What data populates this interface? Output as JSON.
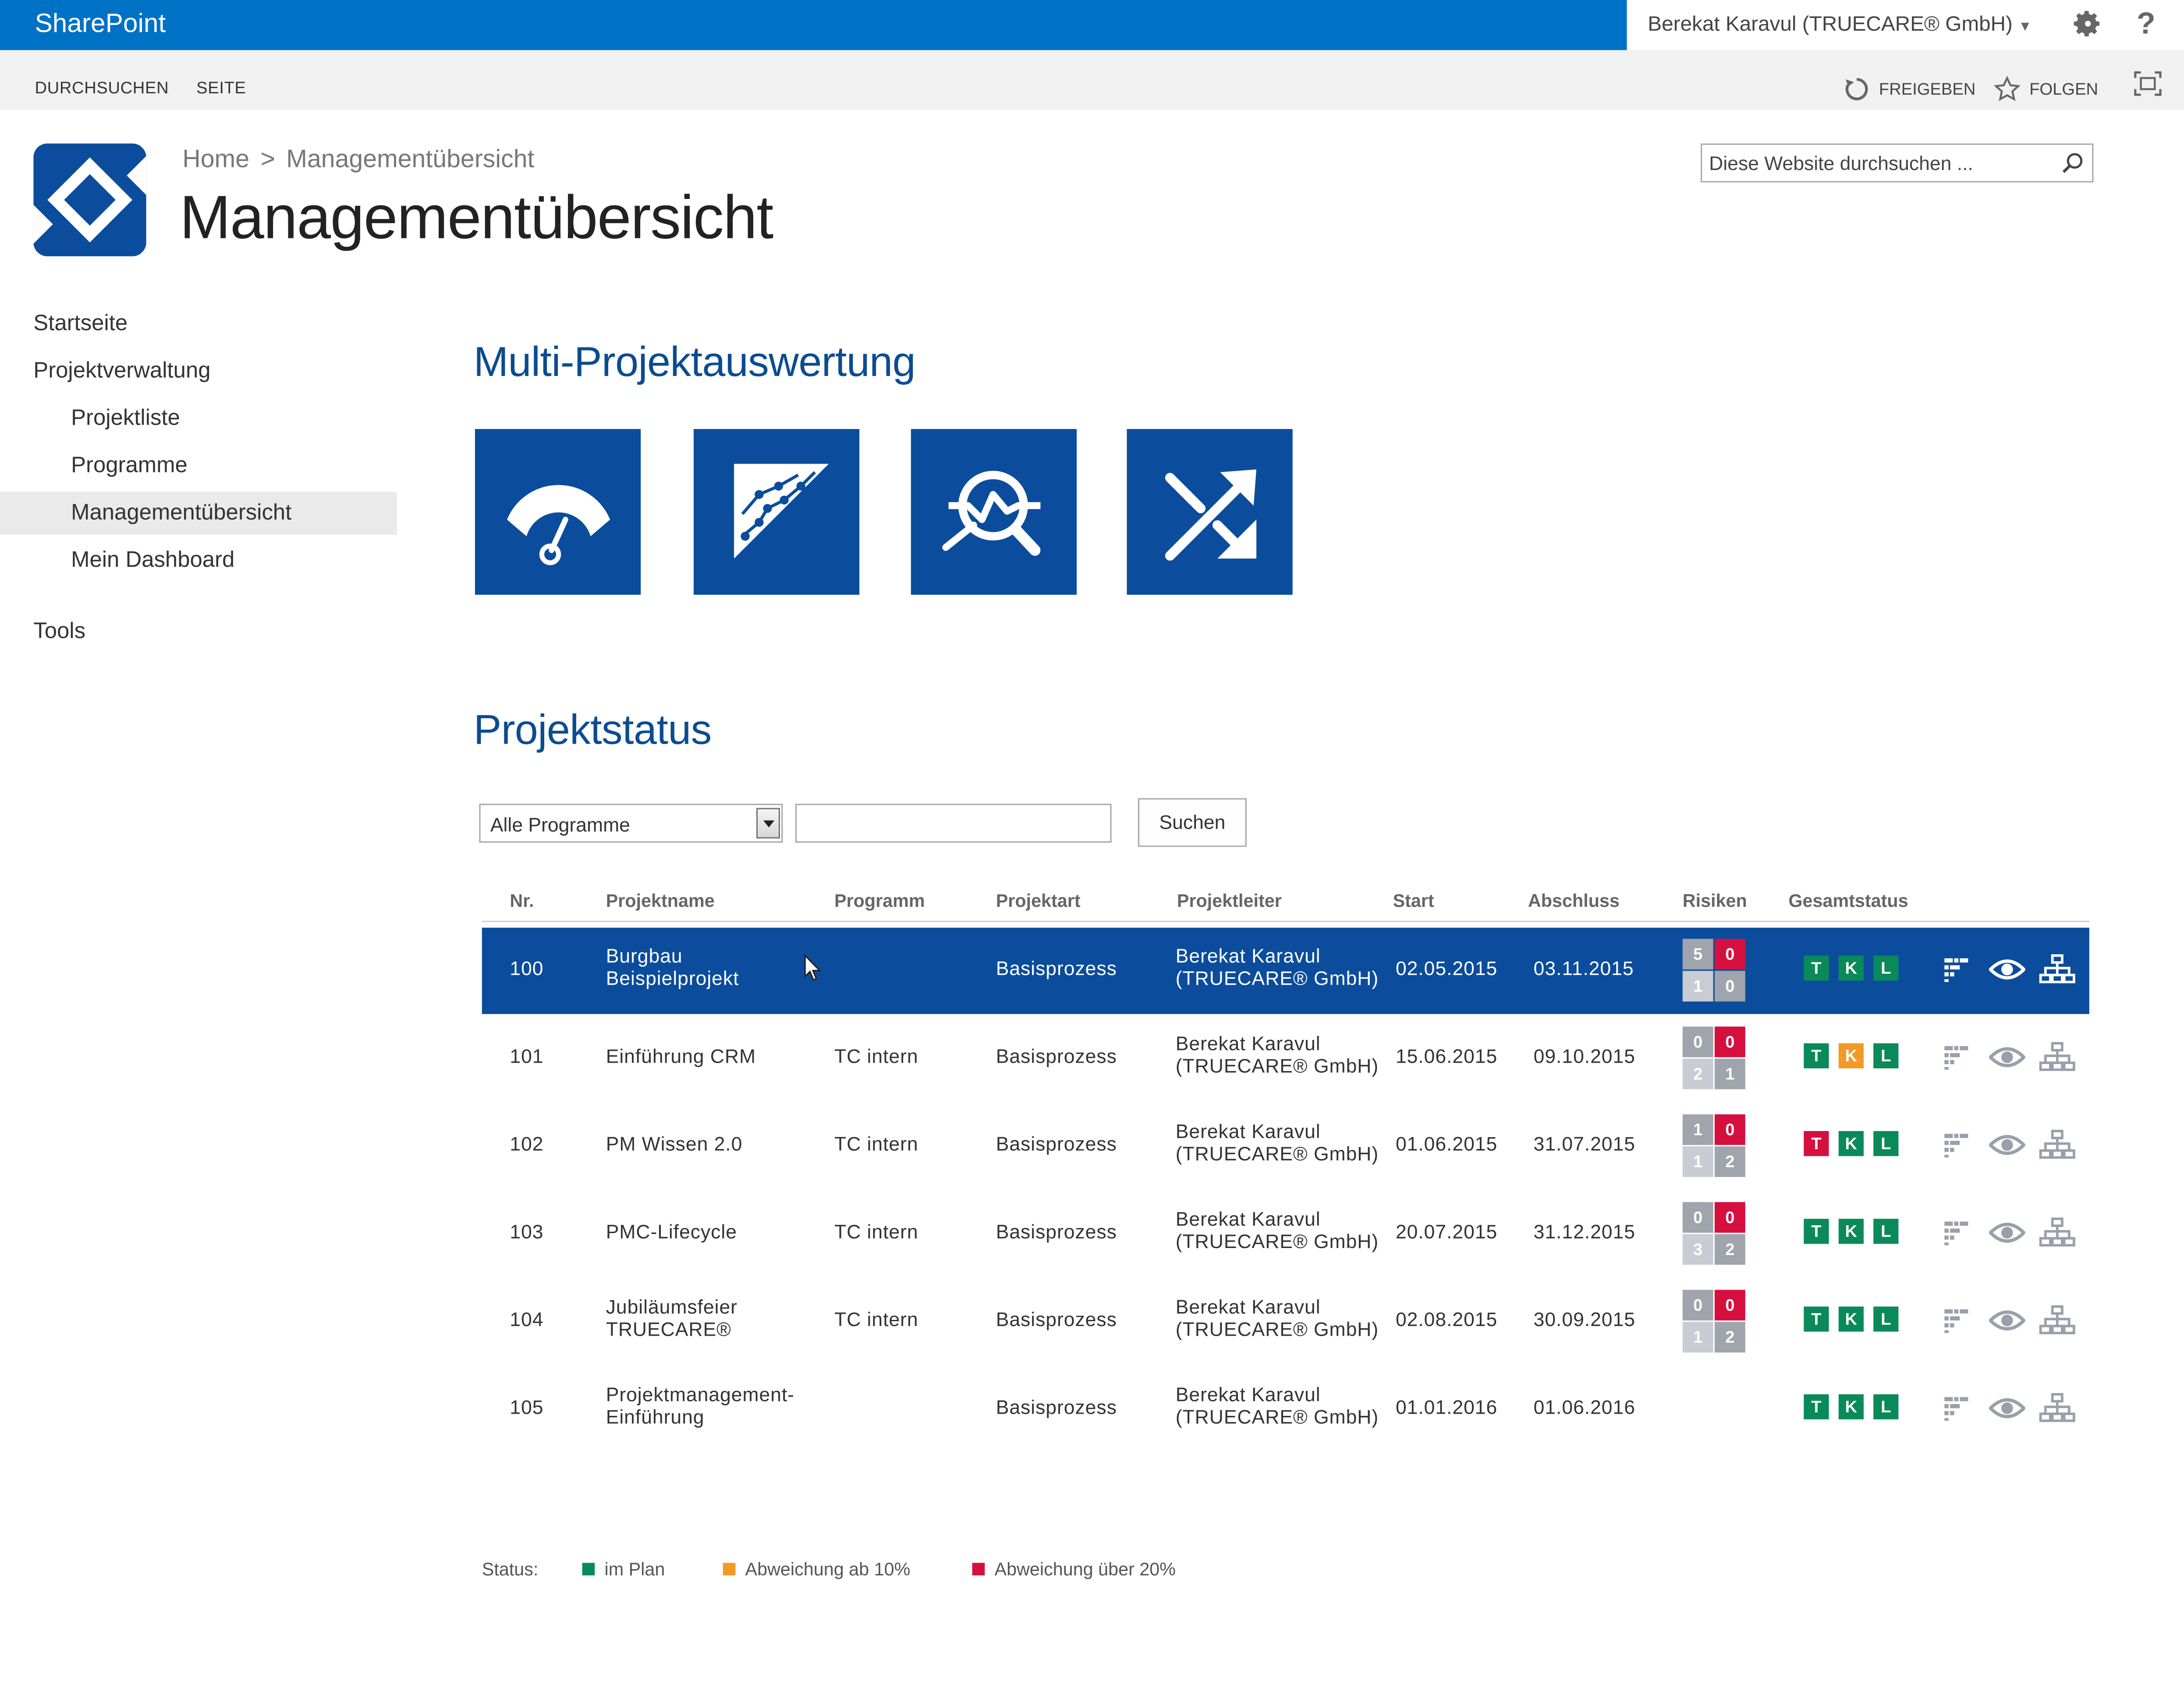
{
  "suite_bar": {
    "app_name": "SharePoint",
    "user_name": "Berekat Karavul (TRUECARE® GmbH)",
    "help_label": "?"
  },
  "ribbon": {
    "tab_browse": "DURCHSUCHEN",
    "tab_page": "SEITE",
    "share_label": "FREIGEBEN",
    "follow_label": "FOLGEN"
  },
  "header": {
    "breadcrumb_home": "Home",
    "breadcrumb_sep": ">",
    "breadcrumb_current": "Managementübersicht",
    "page_title": "Managementübersicht",
    "search_placeholder": "Diese Website durchsuchen ..."
  },
  "nav": {
    "items": [
      {
        "label": "Startseite"
      },
      {
        "label": "Projektverwaltung"
      },
      {
        "label": "Projektliste"
      },
      {
        "label": "Programme"
      },
      {
        "label": "Managementübersicht",
        "selected": true
      },
      {
        "label": "Mein Dashboard"
      },
      {
        "label": "Tools"
      }
    ]
  },
  "main": {
    "section1_title": "Multi-Projektauswertung",
    "tiles": [
      {
        "icon": "gauge-icon"
      },
      {
        "icon": "trend-chart-icon"
      },
      {
        "icon": "analysis-magnifier-icon"
      },
      {
        "icon": "shuffle-arrows-icon"
      }
    ],
    "section2_title": "Projektstatus",
    "filter_select_value": "Alle Programme",
    "filter_text_value": "",
    "search_button": "Suchen"
  },
  "table": {
    "columns": [
      "Nr.",
      "Projektname",
      "Programm",
      "Projektart",
      "Projektleiter",
      "Start",
      "Abschluss",
      "Risiken",
      "Gesamtstatus"
    ],
    "rows": [
      {
        "nr": "100",
        "name1": "Burgbau",
        "name2": "Beispielprojekt",
        "programm": "",
        "art": "Basisprozess",
        "leiter1": "Berekat Karavul",
        "leiter2": "(TRUECARE® GmbH)",
        "start": "02.05.2015",
        "ende": "03.11.2015",
        "risks": [
          "5",
          "0",
          "1",
          "0"
        ],
        "t": "T",
        "k": "K",
        "l": "L",
        "status": [
          "green",
          "green",
          "green"
        ],
        "selected": true
      },
      {
        "nr": "101",
        "name1": "Einführung CRM",
        "name2": "",
        "programm": "TC intern",
        "art": "Basisprozess",
        "leiter1": "Berekat Karavul",
        "leiter2": "(TRUECARE® GmbH)",
        "start": "15.06.2015",
        "ende": "09.10.2015",
        "risks": [
          "0",
          "0",
          "2",
          "1"
        ],
        "t": "T",
        "k": "K",
        "l": "L",
        "status": [
          "green",
          "orange",
          "green"
        ]
      },
      {
        "nr": "102",
        "name1": "PM Wissen 2.0",
        "name2": "",
        "programm": "TC intern",
        "art": "Basisprozess",
        "leiter1": "Berekat Karavul",
        "leiter2": "(TRUECARE® GmbH)",
        "start": "01.06.2015",
        "ende": "31.07.2015",
        "risks": [
          "1",
          "0",
          "1",
          "2"
        ],
        "t": "T",
        "k": "K",
        "l": "L",
        "status": [
          "red",
          "green",
          "green"
        ]
      },
      {
        "nr": "103",
        "name1": "PMC-Lifecycle",
        "name2": "",
        "programm": "TC intern",
        "art": "Basisprozess",
        "leiter1": "Berekat Karavul",
        "leiter2": "(TRUECARE® GmbH)",
        "start": "20.07.2015",
        "ende": "31.12.2015",
        "risks": [
          "0",
          "0",
          "3",
          "2"
        ],
        "t": "T",
        "k": "K",
        "l": "L",
        "status": [
          "green",
          "green",
          "green"
        ]
      },
      {
        "nr": "104",
        "name1": "Jubiläumsfeier",
        "name2": "TRUECARE®",
        "programm": "TC intern",
        "art": "Basisprozess",
        "leiter1": "Berekat Karavul",
        "leiter2": "(TRUECARE® GmbH)",
        "start": "02.08.2015",
        "ende": "30.09.2015",
        "risks": [
          "0",
          "0",
          "1",
          "2"
        ],
        "t": "T",
        "k": "K",
        "l": "L",
        "status": [
          "green",
          "green",
          "green"
        ]
      },
      {
        "nr": "105",
        "name1": "Projektmanagement-",
        "name2": "Einführung",
        "programm": "",
        "art": "Basisprozess",
        "leiter1": "Berekat Karavul",
        "leiter2": "(TRUECARE® GmbH)",
        "start": "01.01.2016",
        "ende": "01.06.2016",
        "risks": null,
        "t": "T",
        "k": "K",
        "l": "L",
        "status": [
          "green",
          "green",
          "green"
        ]
      }
    ]
  },
  "legend": {
    "label": "Status:",
    "items": [
      {
        "label": "im Plan",
        "color": "#0a8a5a"
      },
      {
        "label": "Abweichung ab 10%",
        "color": "#f39a26"
      },
      {
        "label": "Abweichung über 20%",
        "color": "#d6103e"
      }
    ]
  },
  "colors": {
    "suite_blue": "#0072c6",
    "tile_blue": "#0b4d9c",
    "heading_blue": "#0b4c91",
    "status_green": "#0a8a5a",
    "status_orange": "#f39a26",
    "status_red": "#d6103e",
    "risk_gray_dark": "#9fa4ad",
    "risk_gray_light": "#c9ccd2"
  }
}
